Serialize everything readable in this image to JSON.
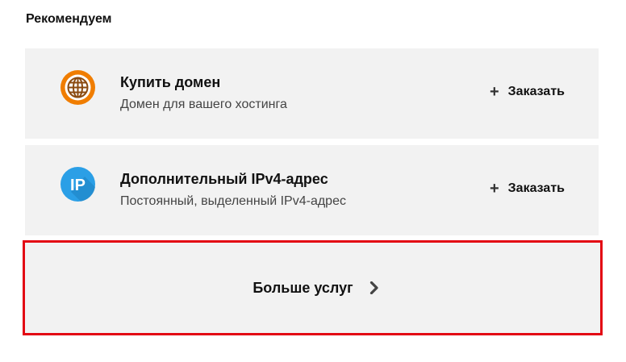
{
  "section": {
    "title": "Рекомендуем"
  },
  "recommendations": [
    {
      "title": "Купить домен",
      "subtitle": "Домен для вашего хостинга",
      "icon": "globe-icon",
      "icon_color": "#f07d00",
      "action_label": "Заказать",
      "action_icon": "plus-icon"
    },
    {
      "title": "Дополнительный IPv4-адрес",
      "subtitle": "Постоянный, выделенный IPv4-адрес",
      "icon": "ip-icon",
      "icon_text": "IP",
      "icon_color": "#2b9fe6",
      "action_label": "Заказать",
      "action_icon": "plus-icon"
    }
  ],
  "more_services": {
    "label": "Больше услуг",
    "icon": "chevron-right-icon",
    "highlight_color": "#e30613"
  }
}
